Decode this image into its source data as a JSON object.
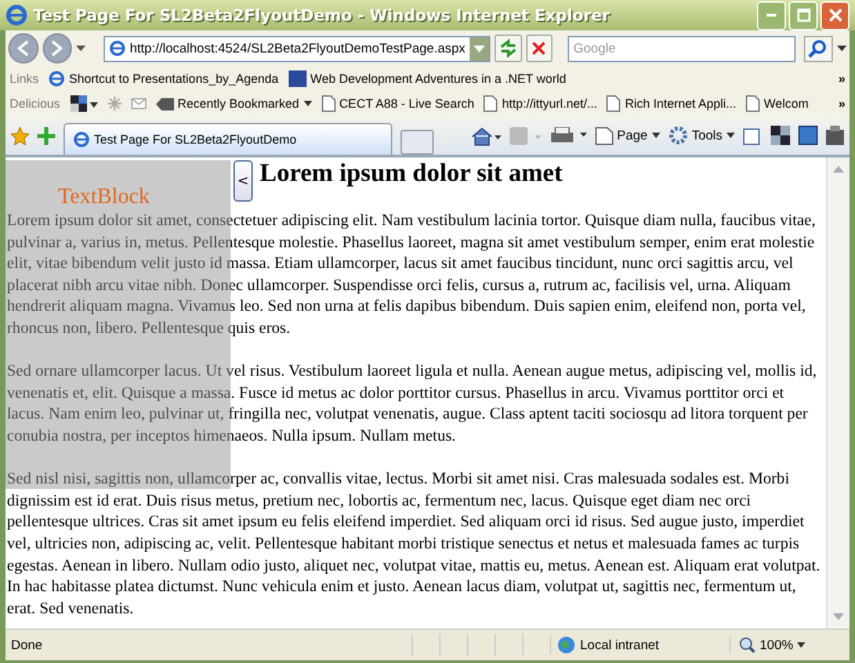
{
  "window": {
    "title": "Test Page For SL2Beta2FlyoutDemo - Windows Internet Explorer"
  },
  "address": {
    "value": "http://localhost:4524/SL2Beta2FlyoutDemoTestPage.aspx"
  },
  "search": {
    "placeholder": "Google"
  },
  "links_bar": {
    "label": "Links",
    "items": [
      {
        "text": "Shortcut to Presentations_by_Agenda",
        "kind": "ie"
      },
      {
        "text": "Web Development Adventures in a .NET world",
        "kind": "asp"
      }
    ],
    "more": "»"
  },
  "delicious_bar": {
    "label": "Delicious",
    "items": [
      {
        "text": "Recently Bookmarked",
        "kind": "tag"
      },
      {
        "text": "CECT A88 - Live Search",
        "kind": "page"
      },
      {
        "text": "http://ittyurl.net/...",
        "kind": "page"
      },
      {
        "text": "Rich Internet Appli...",
        "kind": "page"
      },
      {
        "text": "Welcom",
        "kind": "page"
      }
    ],
    "more": "»"
  },
  "tab": {
    "title": "Test Page For SL2Beta2FlyoutDemo",
    "selected": true
  },
  "command_bar": [
    {
      "text": "Page",
      "kind": "page"
    },
    {
      "text": "Tools",
      "kind": "tools"
    }
  ],
  "flyout": {
    "text": "TextBlock",
    "button": "<",
    "open": true
  },
  "page": {
    "heading": "Lorem ipsum dolor sit amet",
    "paragraphs": [
      "Lorem ipsum dolor sit amet, consectetuer adipiscing elit. Nam vestibulum lacinia tortor. Quisque diam nulla, faucibus vitae, pulvinar a, varius in, metus. Pellentesque molestie. Phasellus laoreet, magna sit amet vestibulum semper, enim erat molestie elit, vitae bibendum velit justo id massa. Etiam ullamcorper, lacus sit amet faucibus tincidunt, nunc orci sagittis arcu, vel placerat nibh arcu vitae nibh. Donec ullamcorper. Suspendisse orci felis, cursus a, rutrum ac, facilisis vel, urna. Aliquam hendrerit aliquam magna. Vivamus leo. Sed non urna at felis dapibus bibendum. Duis sapien enim, eleifend non, porta vel, rhoncus non, libero. Pellentesque quis eros.",
      "Sed ornare ullamcorper lacus. Ut vel risus. Vestibulum laoreet ligula et nulla. Aenean augue metus, adipiscing vel, mollis id, venenatis et, elit. Quisque a massa. Fusce id metus ac dolor porttitor cursus. Phasellus in arcu. Vivamus porttitor orci et lacus. Nam enim leo, pulvinar ut, fringilla nec, volutpat venenatis, augue. Class aptent taciti sociosqu ad litora torquent per conubia nostra, per inceptos himenaeos. Nulla ipsum. Nullam metus.",
      "Sed nisl nisi, sagittis non, ullamcorper ac, convallis vitae, lectus. Morbi sit amet nisi. Cras malesuada sodales est. Morbi dignissim est id erat. Duis risus metus, pretium nec, lobortis ac, fermentum nec, lacus. Quisque eget diam nec orci pellentesque ultrices. Cras sit amet ipsum eu felis eleifend imperdiet. Sed aliquam orci id risus. Sed augue justo, imperdiet vel, ultricies non, adipiscing ac, velit. Pellentesque habitant morbi tristique senectus et netus et malesuada fames ac turpis egestas. Aenean in libero. Nullam odio justo, aliquet nec, volutpat vitae, mattis eu, metus. Aenean est. Aliquam erat volutpat. In hac habitasse platea dictumst. Nunc vehicula enim et justo. Aenean lacus diam, volutpat ut, sagittis nec, fermentum ut, erat. Sed venenatis."
    ]
  },
  "status_bar": {
    "text": "Done",
    "zone": "Local intranet",
    "zoom": "100%"
  }
}
